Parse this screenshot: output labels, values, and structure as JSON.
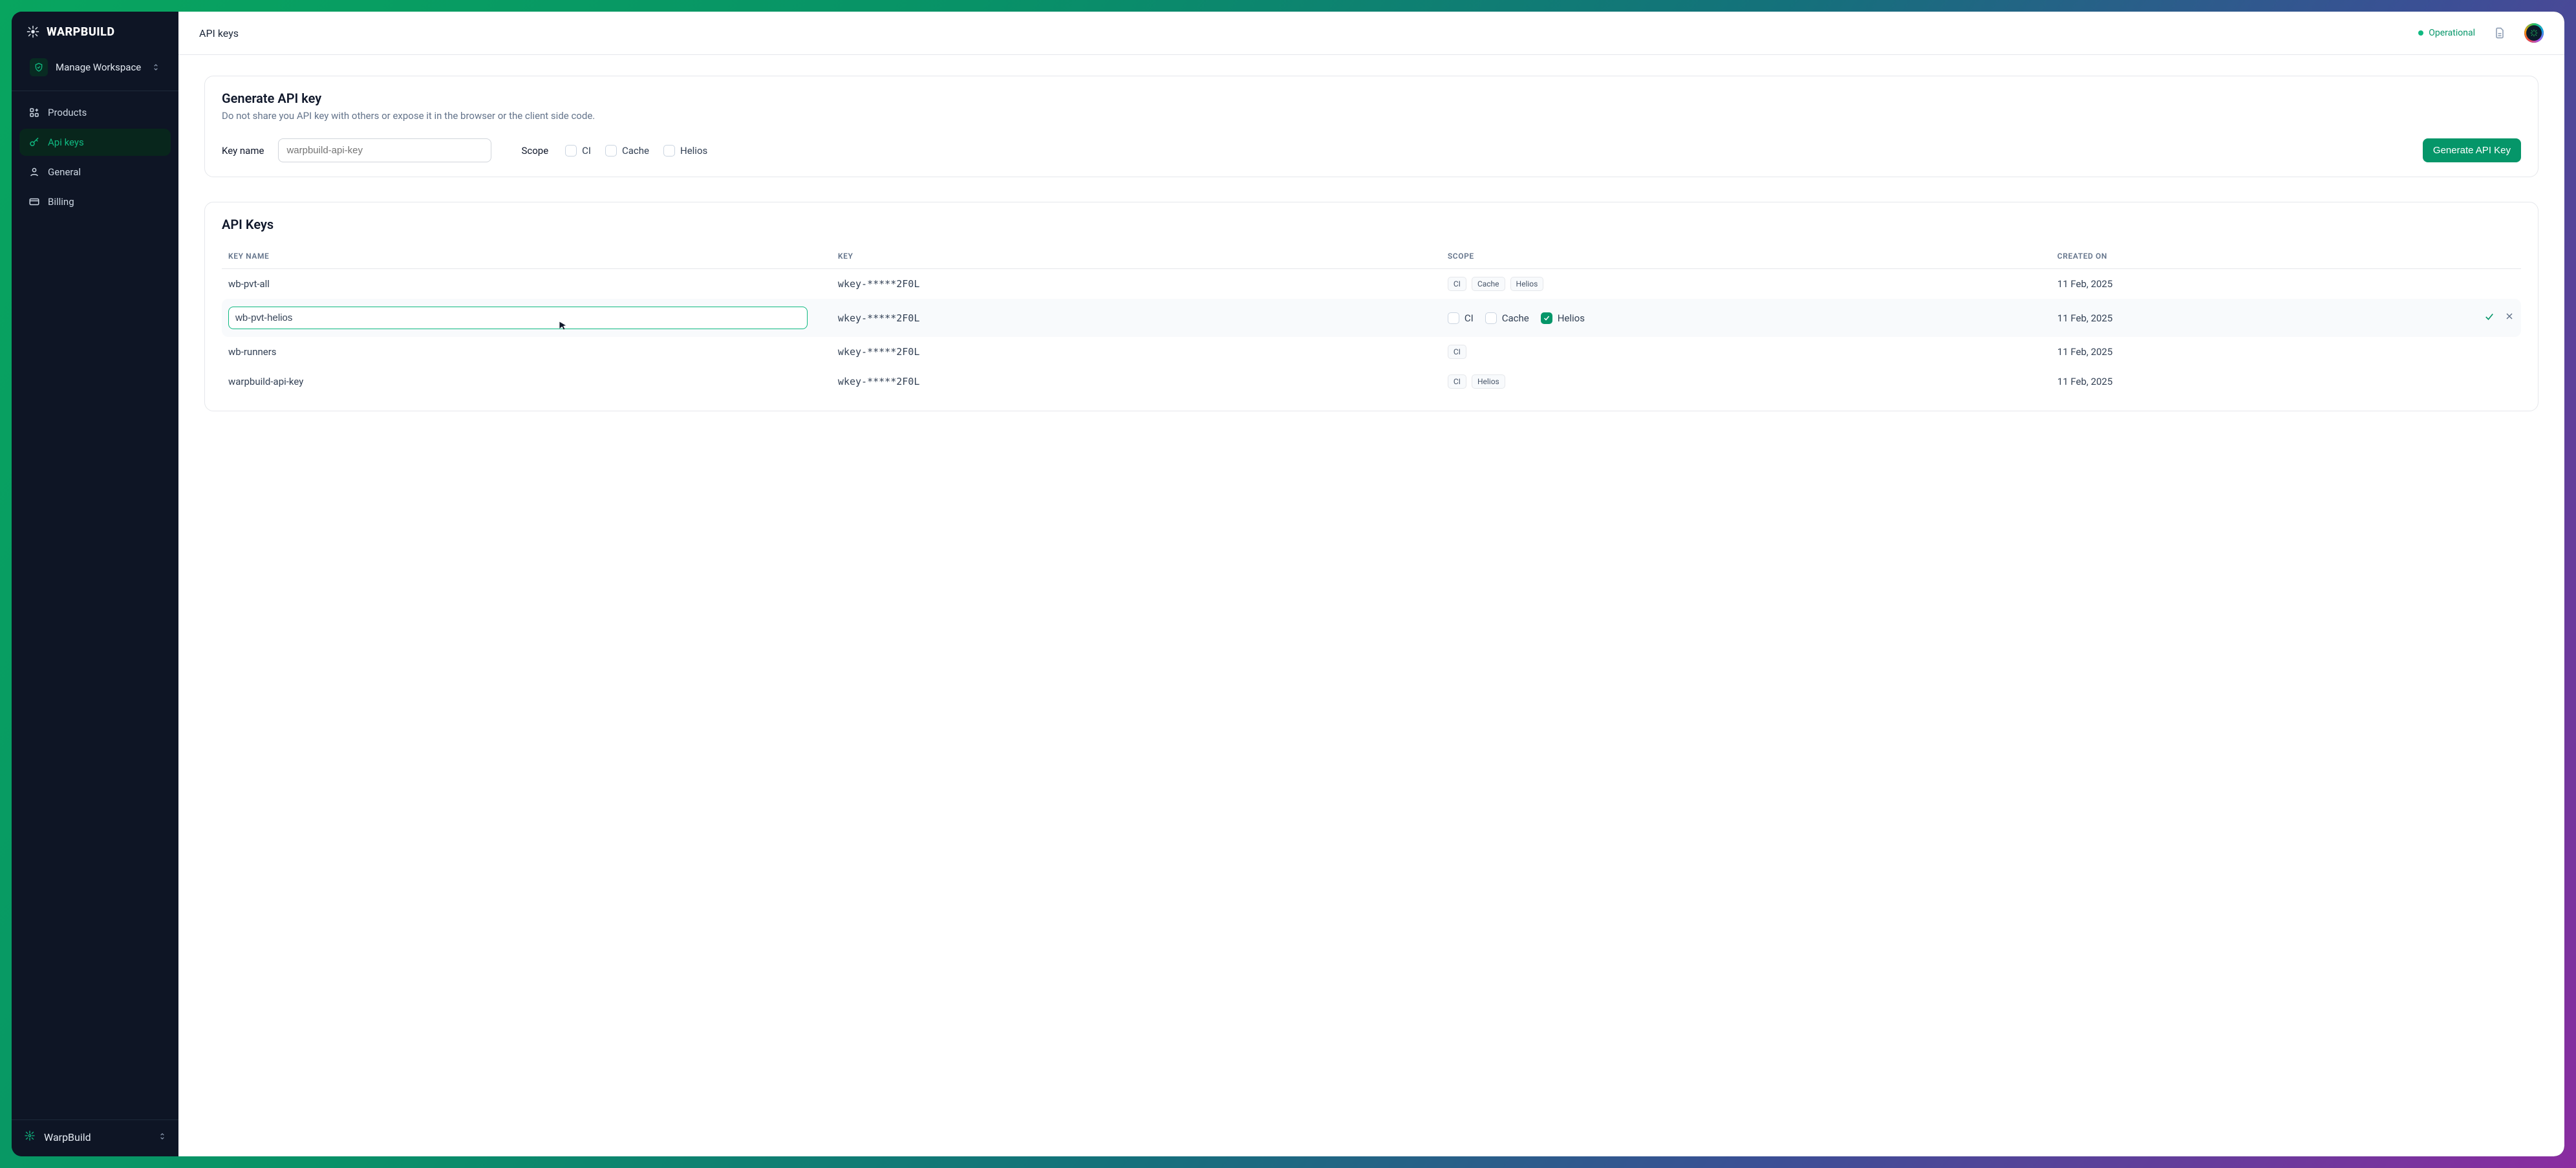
{
  "brand": {
    "name": "WARPBUILD"
  },
  "workspace": {
    "label": "Manage Workspace"
  },
  "nav": {
    "products": "Products",
    "api_keys": "Api keys",
    "general": "General",
    "billing": "Billing"
  },
  "org_switch": {
    "label": "WarpBuild"
  },
  "header": {
    "title": "API keys",
    "status": "Operational"
  },
  "generate": {
    "title": "Generate API key",
    "subtitle": "Do not share you API key with others or expose it in the browser or the client side code.",
    "key_name_label": "Key name",
    "key_name_placeholder": "warpbuild-api-key",
    "scope_label": "Scope",
    "scopes": {
      "ci": "CI",
      "cache": "Cache",
      "helios": "Helios"
    },
    "button": "Generate API Key"
  },
  "list": {
    "title": "API Keys",
    "columns": {
      "name": "KEY NAME",
      "key": "KEY",
      "scope": "SCOPE",
      "created": "CREATED ON"
    },
    "rows": [
      {
        "name": "wb-pvt-all",
        "key": "wkey-*****2F0L",
        "scopes": [
          "CI",
          "Cache",
          "Helios"
        ],
        "created": "11 Feb, 2025",
        "editing": false
      },
      {
        "name": "wb-pvt-helios",
        "key": "wkey-*****2F0L",
        "scopes_check": {
          "ci": false,
          "cache": false,
          "helios": true
        },
        "scope_labels": {
          "ci": "CI",
          "cache": "Cache",
          "helios": "Helios"
        },
        "created": "11 Feb, 2025",
        "editing": true
      },
      {
        "name": "wb-runners",
        "key": "wkey-*****2F0L",
        "scopes": [
          "CI"
        ],
        "created": "11 Feb, 2025",
        "editing": false
      },
      {
        "name": "warpbuild-api-key",
        "key": "wkey-*****2F0L",
        "scopes": [
          "CI",
          "Helios"
        ],
        "created": "11 Feb, 2025",
        "editing": false
      }
    ]
  }
}
